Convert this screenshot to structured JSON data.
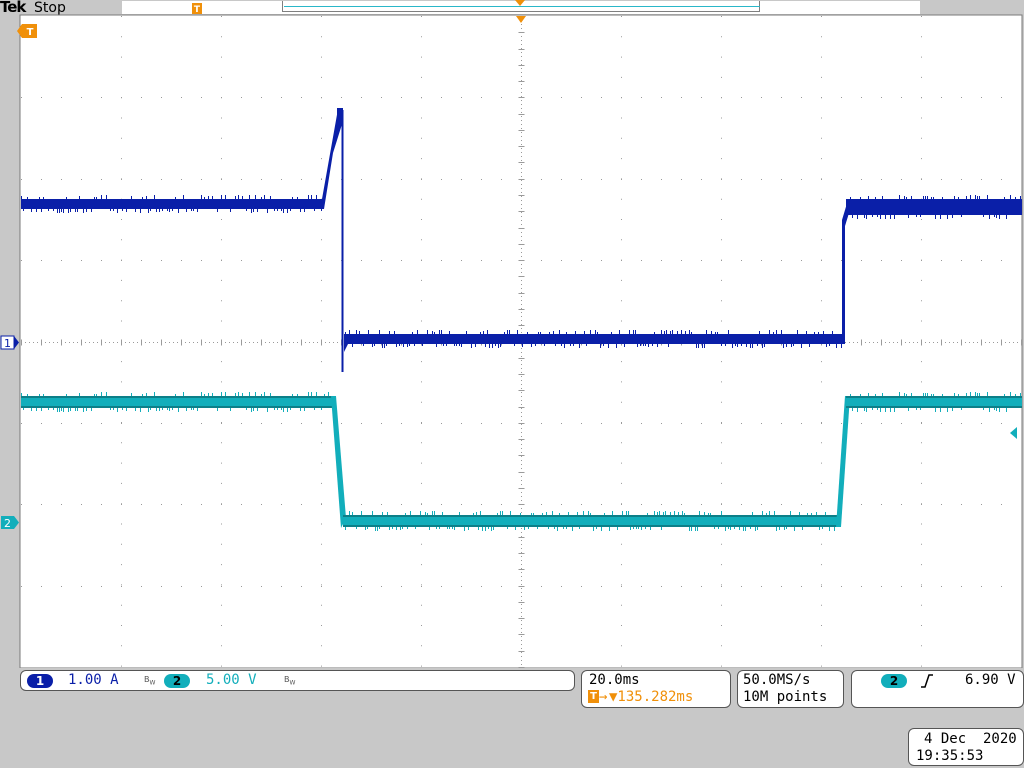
{
  "header": {
    "logo": "Tek",
    "acq_state": "Stop"
  },
  "colors": {
    "ch1": "#0a1fa8",
    "ch2": "#12aebb",
    "trigger": "#f0900a",
    "graticule": "#9a9a9a",
    "screen_bg": "#ffffff"
  },
  "markers": {
    "trigger_marker": "T",
    "ch1_ground_marker": "1",
    "ch2_ground_marker": "2"
  },
  "channels": {
    "ch1": {
      "number": "1",
      "scale": "1.00 A",
      "bandwidth_limit": "BW"
    },
    "ch2": {
      "number": "2",
      "scale": "5.00 V",
      "bandwidth_limit": "BW"
    }
  },
  "timebase": {
    "scale": "20.0ms",
    "trigger_delay": "▼135.282ms"
  },
  "acquisition": {
    "sample_rate": "50.0MS/s",
    "record_length": "10M points"
  },
  "trigger": {
    "source": "2",
    "slope_icon": "rising-edge-icon",
    "level": "6.90 V"
  },
  "datetime": {
    "date": "4 Dec  2020",
    "time": "19:35:53"
  }
}
